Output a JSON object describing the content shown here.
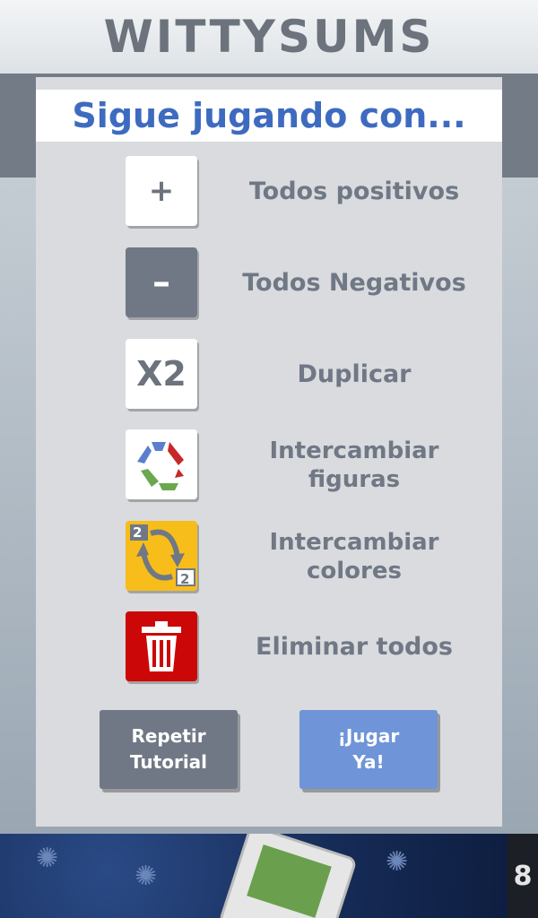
{
  "app": {
    "title": "WITTYSUMS"
  },
  "panel": {
    "heading": "Sigue jugando con...",
    "items": [
      {
        "icon": "plus-tile-icon",
        "glyph": "+",
        "label": "Todos positivos"
      },
      {
        "icon": "minus-tile-icon",
        "glyph": "–",
        "label": "Todos Negativos"
      },
      {
        "icon": "x2-tile-icon",
        "glyph": "X2",
        "label": "Duplicar"
      },
      {
        "icon": "swap-shapes-icon",
        "label": "Intercambiar figuras"
      },
      {
        "icon": "swap-colors-icon",
        "badge": "2",
        "label": "Intercambiar colores"
      },
      {
        "icon": "trash-icon",
        "label": "Eliminar todos"
      }
    ],
    "buttons": {
      "repeat": "Repetir\nTutorial",
      "play": "¡Jugar\nYa!"
    }
  },
  "ad": {
    "side_label": "8"
  },
  "colors": {
    "accent_blue": "#3e6bc0",
    "text_gray": "#707886",
    "play_button": "#6f94d8",
    "delete_red": "#cc0707",
    "swap_yellow": "#f7bd1a"
  }
}
